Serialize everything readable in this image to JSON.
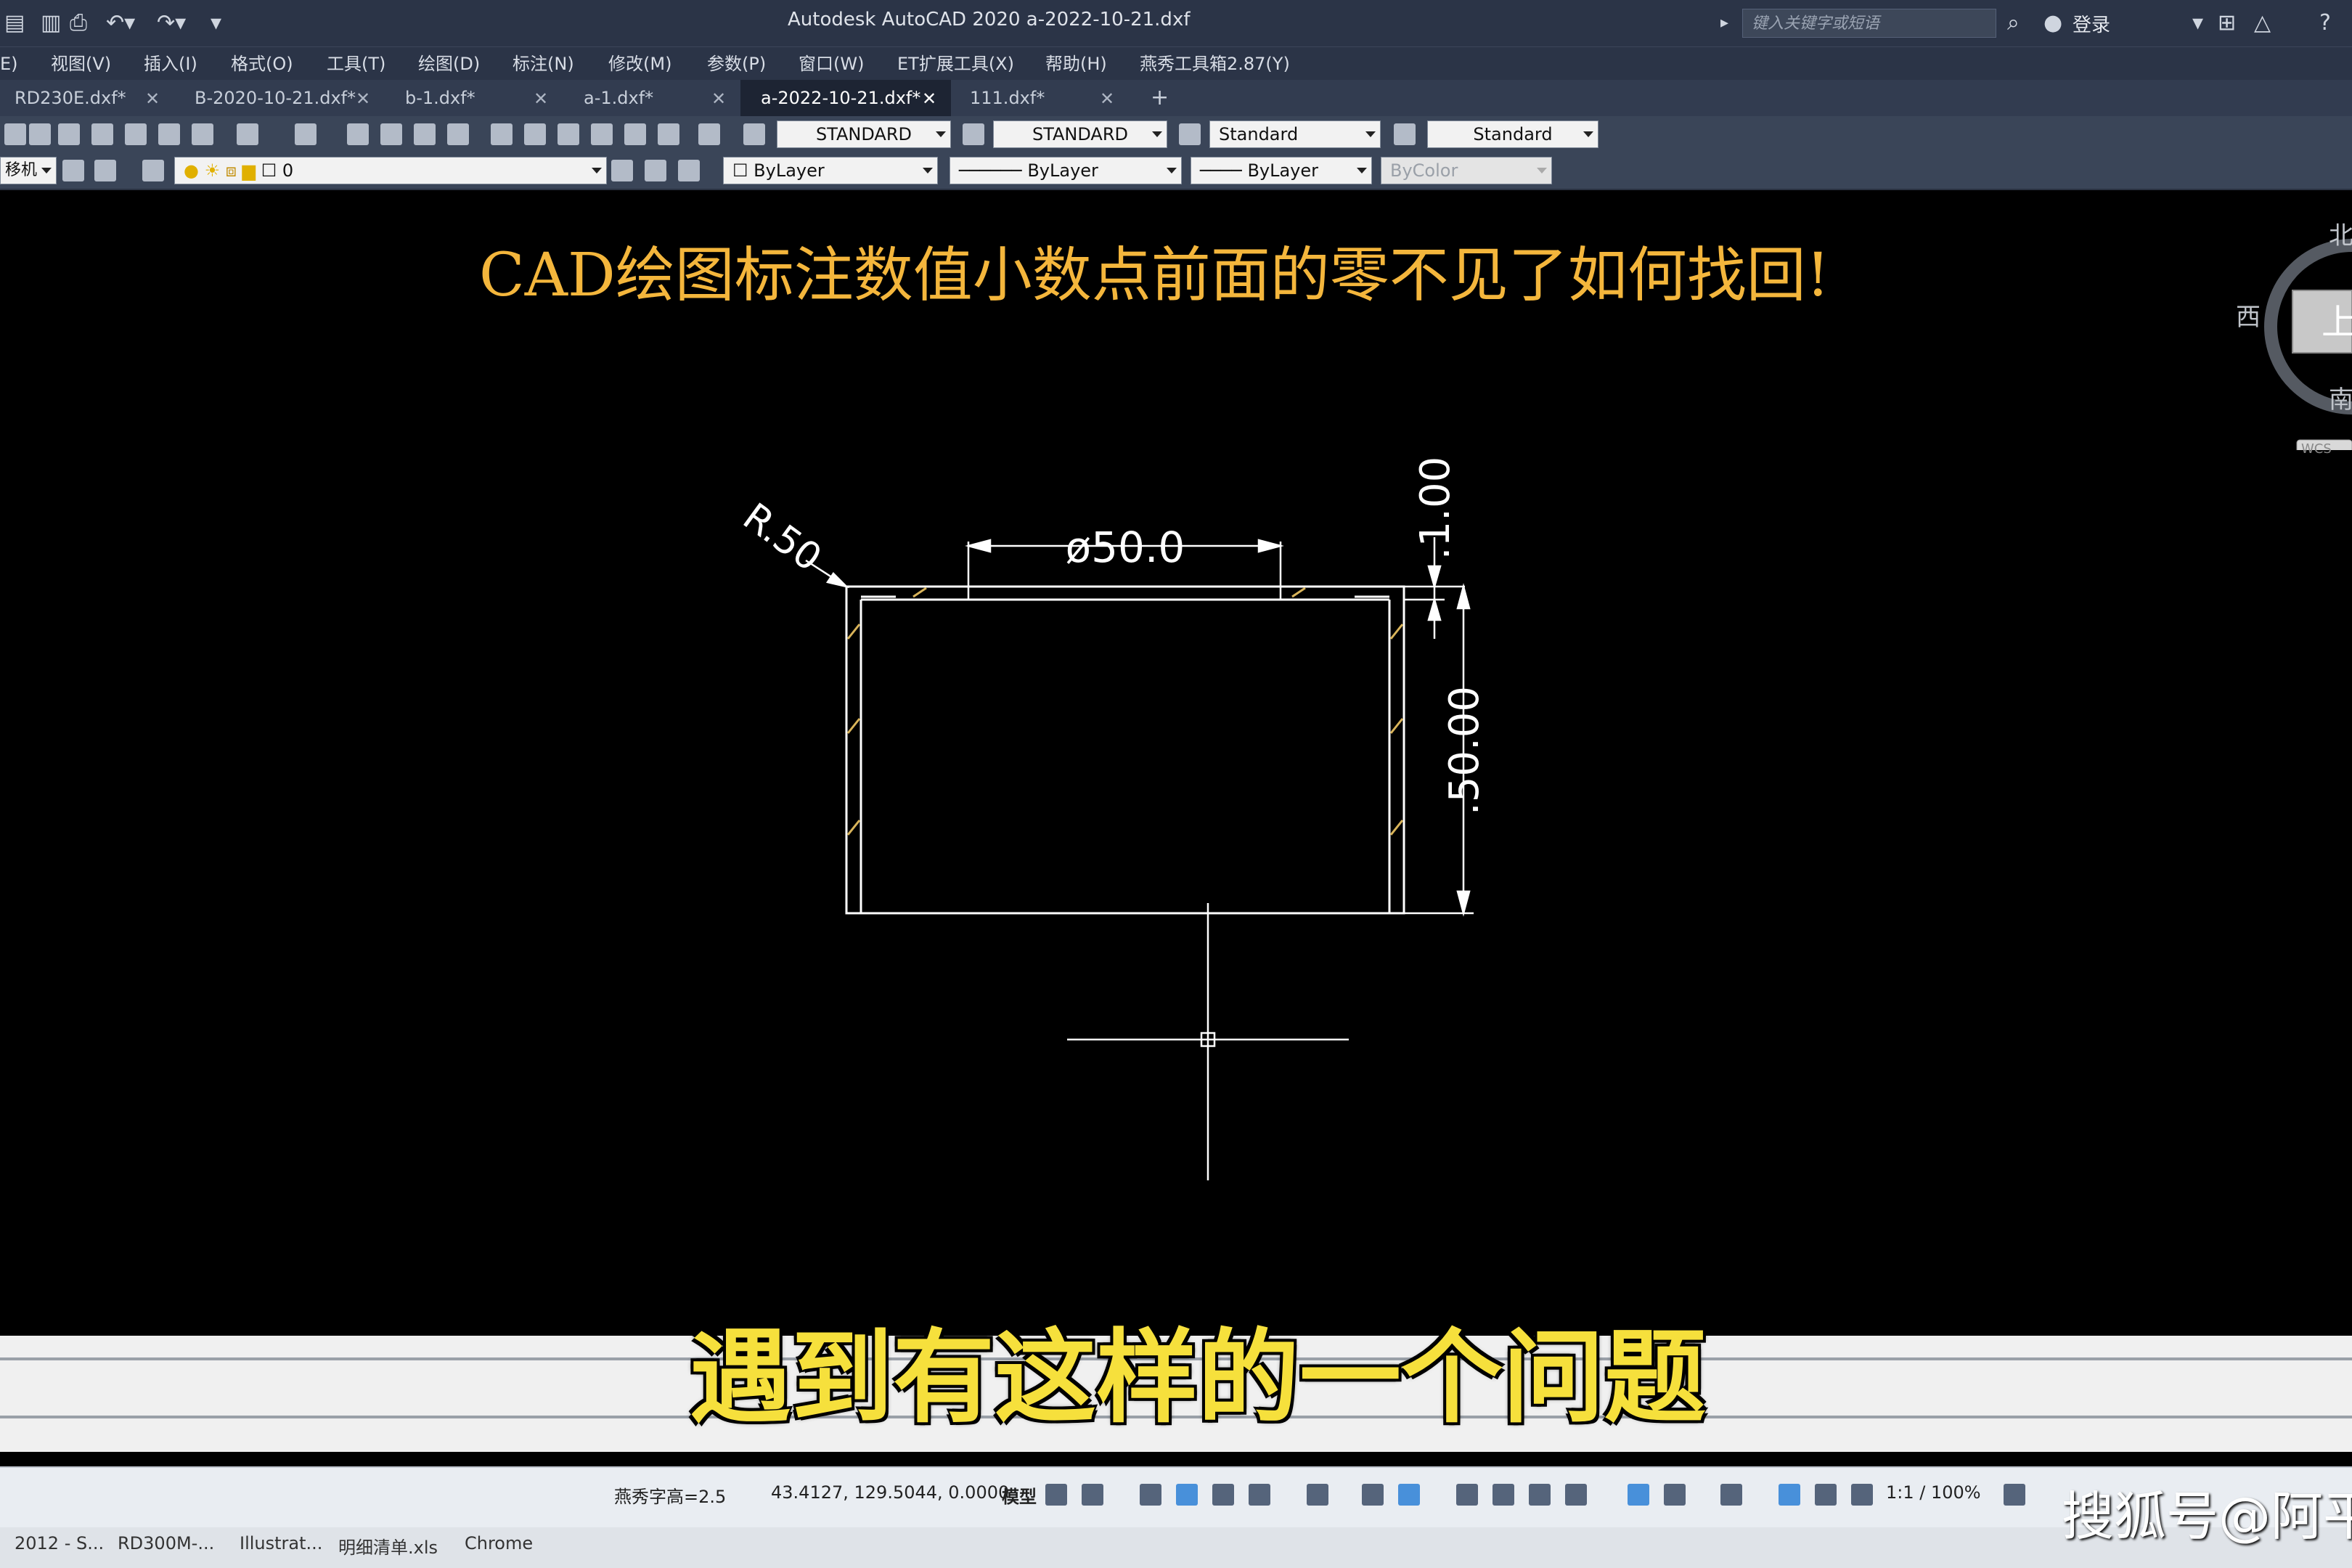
{
  "titlebar": {
    "app_title": "Autodesk AutoCAD 2020    a-2022-10-21.dxf",
    "search_placeholder": "键入关键字或短语",
    "login": "登录"
  },
  "menu": [
    "E)",
    "视图(V)",
    "插入(I)",
    "格式(O)",
    "工具(T)",
    "绘图(D)",
    "标注(N)",
    "修改(M)",
    "参数(P)",
    "窗口(W)",
    "ET扩展工具(X)",
    "帮助(H)",
    "燕秀工具箱2.87(Y)"
  ],
  "tabs": [
    {
      "label": "RD230E.dxf*",
      "active": false
    },
    {
      "label": "B-2020-10-21.dxf*",
      "active": false
    },
    {
      "label": "b-1.dxf*",
      "active": false
    },
    {
      "label": "a-1.dxf*",
      "active": false
    },
    {
      "label": "a-2022-10-21.dxf*",
      "active": true
    },
    {
      "label": "111.dxf*",
      "active": false
    }
  ],
  "tab_add": "+",
  "toolbar1": {
    "text_style": "STANDARD",
    "dim_style": "STANDARD",
    "table_style": "Standard",
    "mleader_style": "Standard"
  },
  "toolbar2": {
    "workspace": "移机",
    "layer": "0",
    "color": "ByLayer",
    "linetype": "ByLayer",
    "lineweight": "ByLayer",
    "plotstyle": "ByColor"
  },
  "canvas": {
    "headline": "CAD绘图标注数值小数点前面的零不见了如何找回!",
    "dims": {
      "radius": "R.50",
      "diameter": "ø50.0",
      "thickness": ".1.00",
      "height": ".50.00"
    }
  },
  "viewcube": {
    "north": "北",
    "west": "西",
    "south": "南",
    "top_face": "上",
    "wcs": "WCS"
  },
  "subtitle": "遇到有这样的一个问题",
  "statusbar": {
    "text_height": "燕秀字高=2.5",
    "coords": "43.4127, 129.5044, 0.0000",
    "model": "模型",
    "scale": "1:1 / 100%"
  },
  "taskbar": [
    "2012 - S...",
    "RD300M-...",
    "Illustrat...",
    "明细清单.xls",
    "Chrome"
  ],
  "watermark": "搜狐号@阿平",
  "colors": {
    "headline": "#f4b63c",
    "subtitle": "#f6e03c",
    "drawing_lines": "#ffffff",
    "hatch": "#d9b45a",
    "ui_dark": "#2b3447"
  }
}
